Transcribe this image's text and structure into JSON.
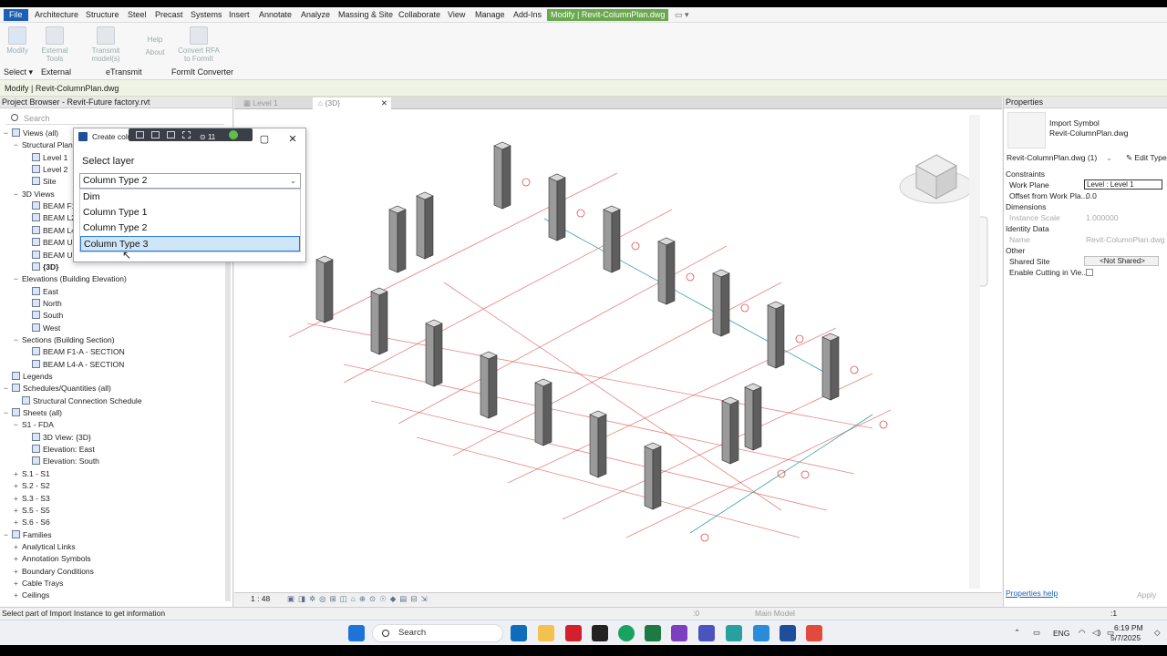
{
  "ribbon": {
    "tabs": [
      "File",
      "Architecture",
      "Structure",
      "Steel",
      "Precast",
      "Systems",
      "Insert",
      "Annotate",
      "Analyze",
      "Massing & Site",
      "Collaborate",
      "View",
      "Manage",
      "Add-Ins",
      "Modify | Revit-ColumnPlan.dwg"
    ],
    "buttons": {
      "modify": "Modify",
      "external_tools": "External Tools",
      "transmit": "Transmit model(s)",
      "help": "Help",
      "about": "About",
      "convert": "Convert RFA to FormIt"
    },
    "panels": {
      "select": "Select ▾",
      "external": "External",
      "etransmit": "eTransmit",
      "formit": "FormIt Converter"
    }
  },
  "options_bar": "Modify | Revit-ColumnPlan.dwg",
  "browser": {
    "title": "Project Browser - Revit-Future factory.rvt",
    "search_placeholder": "Search",
    "items": [
      {
        "t": "−",
        "label": "Views (all)",
        "d": 0,
        "icon": true
      },
      {
        "t": "−",
        "label": "Structural Plans",
        "d": 1
      },
      {
        "t": "",
        "label": "Level 1",
        "d": 2,
        "icon": true
      },
      {
        "t": "",
        "label": "Level 2",
        "d": 2,
        "icon": true
      },
      {
        "t": "",
        "label": "Site",
        "d": 2,
        "icon": true
      },
      {
        "t": "−",
        "label": "3D Views",
        "d": 1
      },
      {
        "t": "",
        "label": "BEAM F1",
        "d": 2,
        "icon": true
      },
      {
        "t": "",
        "label": "BEAM L2",
        "d": 2,
        "icon": true
      },
      {
        "t": "",
        "label": "BEAM L4",
        "d": 2,
        "icon": true
      },
      {
        "t": "",
        "label": "BEAM U",
        "d": 2,
        "icon": true
      },
      {
        "t": "",
        "label": "BEAM U",
        "d": 2,
        "icon": true
      },
      {
        "t": "",
        "label": "{3D}",
        "d": 2,
        "icon": true,
        "sel": true
      },
      {
        "t": "−",
        "label": "Elevations (Building Elevation)",
        "d": 1
      },
      {
        "t": "",
        "label": "East",
        "d": 2,
        "icon": true
      },
      {
        "t": "",
        "label": "North",
        "d": 2,
        "icon": true
      },
      {
        "t": "",
        "label": "South",
        "d": 2,
        "icon": true
      },
      {
        "t": "",
        "label": "West",
        "d": 2,
        "icon": true
      },
      {
        "t": "−",
        "label": "Sections (Building Section)",
        "d": 1
      },
      {
        "t": "",
        "label": "BEAM F1-A - SECTION",
        "d": 2,
        "icon": true
      },
      {
        "t": "",
        "label": "BEAM L4-A - SECTION",
        "d": 2,
        "icon": true
      },
      {
        "t": "",
        "label": "Legends",
        "d": 0,
        "icon": true
      },
      {
        "t": "−",
        "label": "Schedules/Quantities (all)",
        "d": 0,
        "icon": true
      },
      {
        "t": "",
        "label": "Structural Connection Schedule",
        "d": 1,
        "icon": true
      },
      {
        "t": "−",
        "label": "Sheets (all)",
        "d": 0,
        "icon": true
      },
      {
        "t": "−",
        "label": "S1 - FDA",
        "d": 1
      },
      {
        "t": "",
        "label": "3D View: {3D}",
        "d": 2,
        "icon": true
      },
      {
        "t": "",
        "label": "Elevation: East",
        "d": 2,
        "icon": true
      },
      {
        "t": "",
        "label": "Elevation: South",
        "d": 2,
        "icon": true
      },
      {
        "t": "+",
        "label": "S.1 - S1",
        "d": 1
      },
      {
        "t": "+",
        "label": "S.2 - S2",
        "d": 1
      },
      {
        "t": "+",
        "label": "S.3 - S3",
        "d": 1
      },
      {
        "t": "+",
        "label": "S.5 - S5",
        "d": 1
      },
      {
        "t": "+",
        "label": "S.6 - S6",
        "d": 1
      },
      {
        "t": "−",
        "label": "Families",
        "d": 0,
        "icon": true
      },
      {
        "t": "+",
        "label": "Analytical Links",
        "d": 1
      },
      {
        "t": "+",
        "label": "Annotation Symbols",
        "d": 1
      },
      {
        "t": "+",
        "label": "Boundary Conditions",
        "d": 1
      },
      {
        "t": "+",
        "label": "Cable Trays",
        "d": 1
      },
      {
        "t": "+",
        "label": "Ceilings",
        "d": 1
      }
    ]
  },
  "view_tabs": [
    "Level 1",
    "{3D}"
  ],
  "view_bottom": {
    "scale": "1 : 48"
  },
  "dialog": {
    "title": "Create colu",
    "toolbar_count": "11",
    "label": "Select layer",
    "selected": "Column Type 2",
    "options": [
      "Dim",
      "Column Type 1",
      "Column Type 2",
      "Column Type 3"
    ],
    "highlighted_index": 3
  },
  "properties": {
    "title": "Properties",
    "type_name": "Import Symbol",
    "type_sub": "Revit-ColumnPlan.dwg",
    "instance_selector": "Revit-ColumnPlan.dwg (1)",
    "edit_type": "Edit Type",
    "sections": {
      "constraints": "Constraints",
      "dimensions": "Dimensions",
      "identity": "Identity Data",
      "other": "Other"
    },
    "rows": {
      "work_plane_label": "Work Plane",
      "work_plane_value": "Level : Level 1",
      "offset_label": "Offset from Work Pla...",
      "offset_value": "0.0",
      "scale_label": "Instance Scale",
      "scale_value": "1.000000",
      "name_label": "Name",
      "name_value": "Revit-ColumnPlan.dwg",
      "shared_label": "Shared Site",
      "shared_value": "<Not Shared>",
      "cut_label": "Enable Cutting in Vie..."
    },
    "help_link": "Properties help",
    "apply": "Apply"
  },
  "status": {
    "message": "Select part of Import Instance to get information",
    "model": "Main Model",
    "sel_count": ":0",
    "filter": ":1"
  },
  "taskbar": {
    "search": "Search",
    "language": "ENG",
    "time": "6:19 PM",
    "date": "5/7/2025"
  },
  "colors": {
    "accent": "#1d5fb4",
    "context_tab": "#6aa84f",
    "grid": "#d9534f",
    "highlight": "#cfe6f8"
  }
}
